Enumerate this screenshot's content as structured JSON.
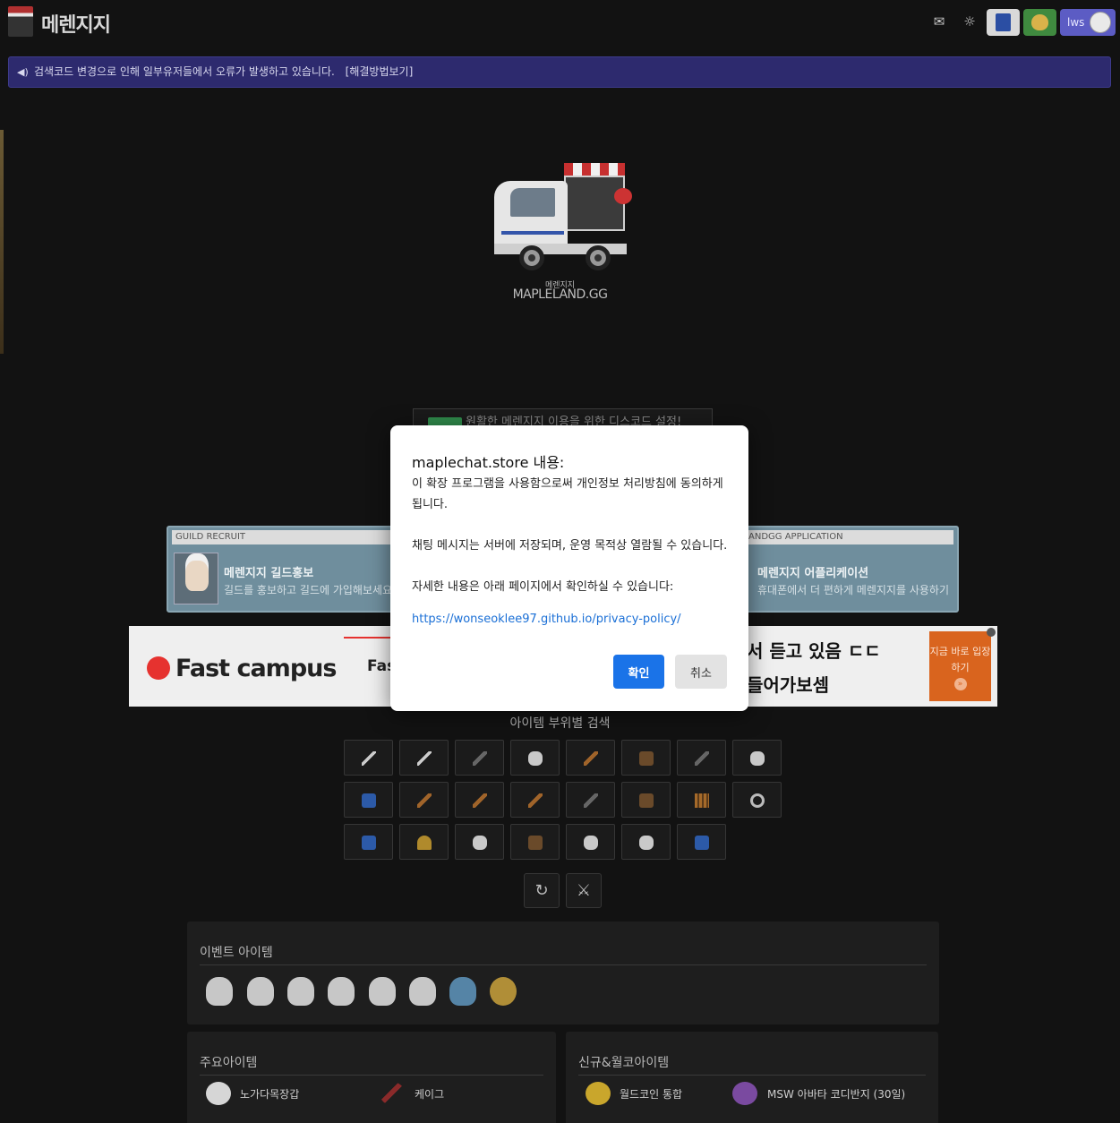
{
  "header": {
    "logo_text": "메렌지지",
    "mail_icon": "mail-icon",
    "theme_icon": "sun-icon",
    "user_label": "lws"
  },
  "notice": {
    "text": "검색코드 변경으로 인해 일부유저들에서 오류가 발생하고 있습니다.",
    "link": "[해결방법보기]"
  },
  "hero": {
    "brand_small": "메렌지지",
    "brand_big": "MAPLELAND.GG",
    "discord_text": "원활한 메렌지지 이용을 위한 디스코드 설정!"
  },
  "cards": {
    "left": {
      "caption": "GUILD RECRUIT",
      "title": "메렌지지 길드홍보",
      "desc": "길드를 홍보하고 길드에 가입해보세요"
    },
    "right": {
      "caption": "ANDGG APPLICATION",
      "title": "메렌지지 어플리케이션",
      "desc": "휴대폰에서 더 편하게 메렌지지를 사용하기"
    }
  },
  "ad": {
    "logo": "Fast campus",
    "logo2": "Fast",
    "line1": "서 듣고 있음 ㄷㄷ",
    "line2": "들어가보셈",
    "cta": "지금 바로 입장하기",
    "cta_arrow": "»"
  },
  "dialog": {
    "title": "maplechat.store 내용:",
    "body": "이 확장 프로그램을 사용함으로써 개인정보 처리방침에 동의하게 됩니다.\n\n채팅 메시지는 서버에 저장되며, 운영 목적상 열람될 수 있습니다.\n\n자세한 내용은 아래 페이지에서 확인하실 수 있습니다:",
    "link": "https://wonseoklee97.github.io/privacy-policy/",
    "ok_label": "확인",
    "cancel_label": "취소"
  },
  "item_search": {
    "label": "아이템 부위별 검색",
    "rows": [
      [
        "one-handed-sword-icon",
        "one-handed-axe-icon",
        "one-handed-blunt-icon",
        "two-handed-axe-icon",
        "spear-icon",
        "wand-icon",
        "dagger-icon",
        "pole-arm-icon"
      ],
      [
        "crossbow-icon",
        "bow-icon",
        "staff-icon",
        "claw-icon",
        "knuckle-icon",
        "gun-icon",
        "throwing-star-icon",
        "ring-icon"
      ],
      [
        "overall-icon",
        "hat-icon",
        "glove-icon",
        "shoes-icon",
        "cape-icon",
        "top-icon",
        "bottom-icon"
      ]
    ],
    "extra_buttons": [
      "price-chart-icon",
      "sword-icon"
    ]
  },
  "event_panel": {
    "title": "이벤트 아이템",
    "icons": [
      "ghost-icon",
      "cloud-icon",
      "dragon-icon",
      "spirit-icon",
      "bird-icon",
      "lion-icon",
      "wave-icon",
      "compass-icon"
    ]
  },
  "main_panel": {
    "title": "주요아이템",
    "items": [
      {
        "icon": "glove-icon",
        "label": "노가다목장갑"
      },
      {
        "icon": "cane-icon",
        "label": "케이그"
      }
    ]
  },
  "new_panel": {
    "title": "신규&월코아이템",
    "items": [
      {
        "icon": "coin-icon",
        "label": "월드코인 통합"
      },
      {
        "icon": "ring-icon",
        "label": "MSW 아바타 코디반지 (30일)"
      }
    ]
  },
  "colors": {
    "background": "#121212",
    "notice_bg": "#2d2a6e",
    "primary_button": "#1a73e8",
    "card_bg": "#6f8e9d",
    "ad_cta": "#d9641e"
  }
}
